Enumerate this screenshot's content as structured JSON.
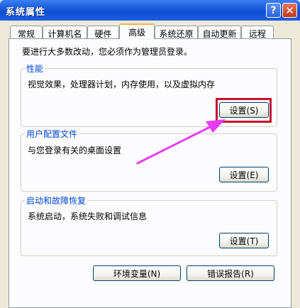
{
  "window": {
    "title": "系统属性",
    "help_glyph": "?",
    "close_glyph": "✕"
  },
  "tabs": [
    {
      "label": "常规"
    },
    {
      "label": "计算机名"
    },
    {
      "label": "硬件"
    },
    {
      "label": "高级"
    },
    {
      "label": "系统还原"
    },
    {
      "label": "自动更新"
    },
    {
      "label": "远程"
    }
  ],
  "active_tab": "高级",
  "intro": "要进行大多数改动，您必须作为管理员登录。",
  "performance": {
    "title": "性能",
    "description": "视觉效果，处理器计划，内存使用，以及虚拟内存",
    "button": "设置(S)"
  },
  "user_profiles": {
    "title": "用户配置文件",
    "description": "与您登录有关的桌面设置",
    "button": "设置(E)"
  },
  "startup_recovery": {
    "title": "启动和故障恢复",
    "description": "系统启动，系统失败和调试信息",
    "button": "设置(T)"
  },
  "bottom_buttons": {
    "env_vars": "环境变量(N)",
    "error_report": "错误报告(R)"
  },
  "colors": {
    "titlebar": "#0e4fd2",
    "highlight": "#c8102e",
    "annotation_arrow": "#e83cf0",
    "group_title": "#0046d5"
  }
}
